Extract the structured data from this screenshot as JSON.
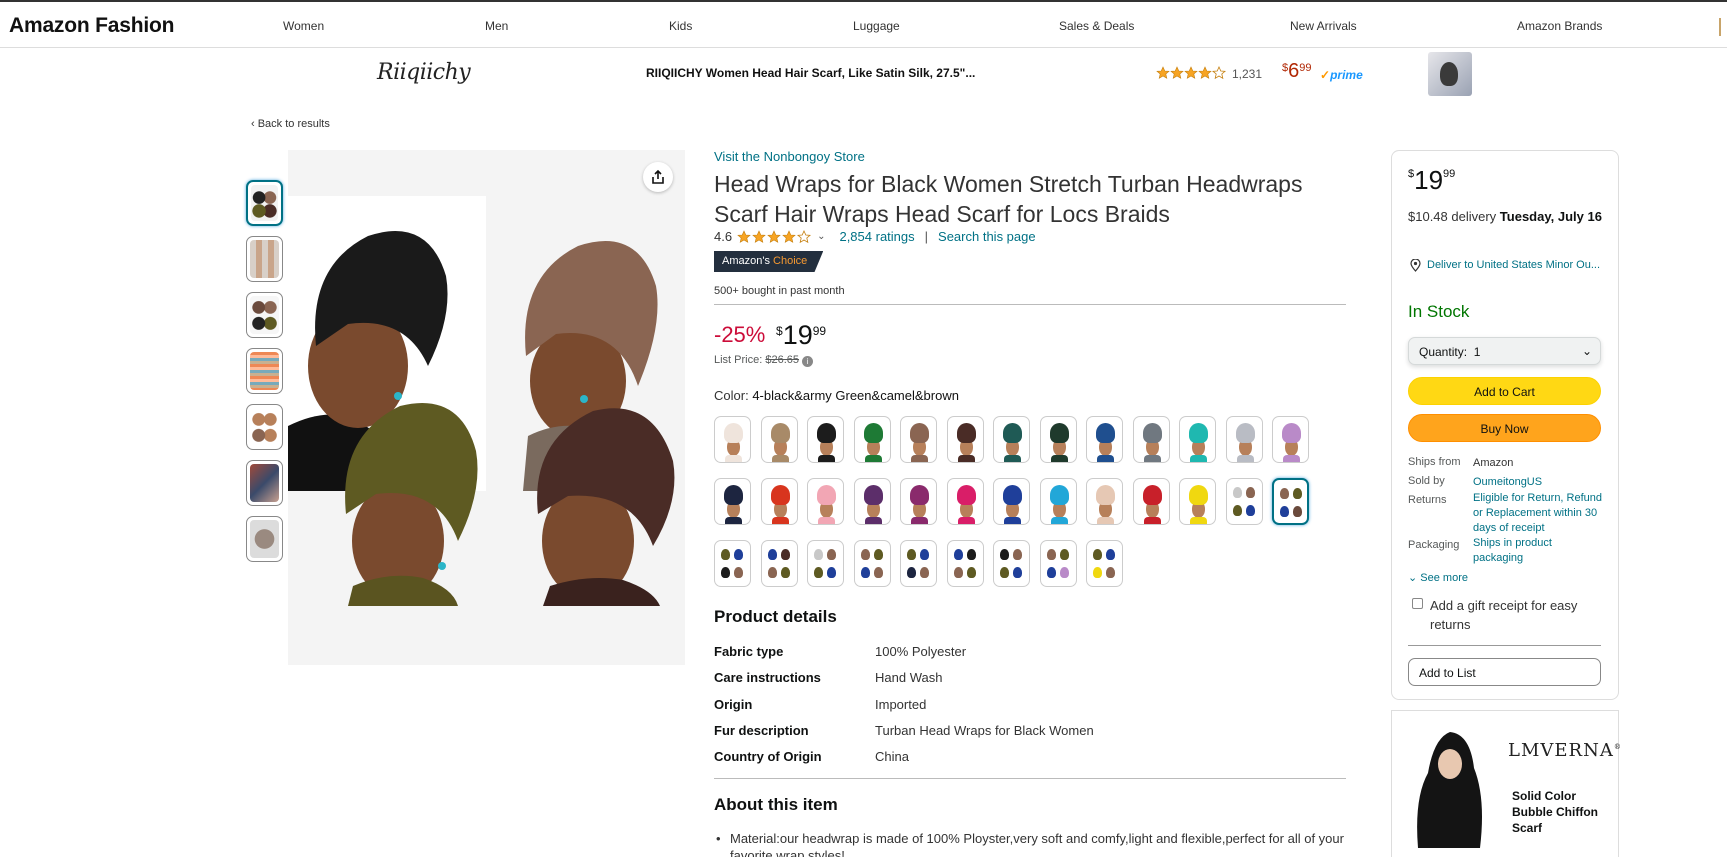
{
  "nav": {
    "brand": "Amazon Fashion",
    "links": [
      "Women",
      "Men",
      "Kids",
      "Luggage",
      "Sales & Deals",
      "New Arrivals",
      "Amazon Brands"
    ]
  },
  "sponsored": {
    "logo": "Riiqiichy",
    "title": "RIIQIICHY Women Head Hair Scarf, Like Satin Silk, 27.5\"...",
    "rating_count": "1,231",
    "price_symbol": "$",
    "price_dollars": "6",
    "price_cents": "99",
    "prime": "prime"
  },
  "back_link": "‹  Back to results",
  "product": {
    "store_link": "Visit the Nonbongoy Store",
    "title": "Head Wraps for Black Women Stretch Turban Headwraps Scarf Hair Wraps Head Scarf for Locs Braids",
    "rating": "4.6",
    "ratings_link": "2,854 ratings",
    "separator": "|",
    "search_link": "Search this page",
    "badge_a": "Amazon's",
    "badge_b": "Choice",
    "bought": "500+ bought in past month",
    "discount": "-25%",
    "price_symbol": "$",
    "price_dollars": "19",
    "price_cents": "99",
    "list_price_label": "List Price:",
    "list_price": "$26.65",
    "color_label": "Color:",
    "color_value": "4-black&army Green&camel&brown"
  },
  "details": {
    "heading": "Product details",
    "rows": [
      {
        "k": "Fabric type",
        "v": "100% Polyester"
      },
      {
        "k": "Care instructions",
        "v": "Hand Wash"
      },
      {
        "k": "Origin",
        "v": "Imported"
      },
      {
        "k": "Fur description",
        "v": "Turban Head Wraps for Black Women"
      },
      {
        "k": "Country of Origin",
        "v": "China"
      }
    ]
  },
  "about": {
    "heading": "About this item",
    "bullet": "Material:our headwrap is made of 100% Ployster,very soft and comfy,light and flexible,perfect for all of your favorite wrap styles!"
  },
  "buybox": {
    "price_symbol": "$",
    "price_dollars": "19",
    "price_cents": "99",
    "delivery": "$10.48 delivery",
    "delivery_date": "Tuesday, July 16",
    "deliver_to": "Deliver to United States Minor Ou...",
    "stock": "In Stock",
    "quantity_label": "Quantity:",
    "quantity_value": "1",
    "add_to_cart": "Add to Cart",
    "buy_now": "Buy Now",
    "ships_from_label": "Ships from",
    "ships_from": "Amazon",
    "sold_by_label": "Sold by",
    "sold_by": "OumeitongUS",
    "returns_label": "Returns",
    "returns": "Eligible for Return, Refund or Replacement within 30 days of receipt",
    "packaging_label": "Packaging",
    "packaging": "Ships in product packaging",
    "see_more": "See more",
    "gift": "Add a gift receipt for easy returns",
    "add_to_list": "Add to List"
  },
  "ad": {
    "logo": "LMVERNA",
    "logo_mark": "®",
    "text": "Solid Color Bubble Chiffon Scarf"
  },
  "swatches": [
    [
      "#efe4dc"
    ],
    [
      "#a88a68"
    ],
    [
      "#1c1c1c"
    ],
    [
      "#1e7a35"
    ],
    [
      "#8a6552"
    ],
    [
      "#4a2c26"
    ],
    [
      "#1f5a55"
    ],
    [
      "#1f3a2c"
    ],
    [
      "#1f4f8f"
    ],
    [
      "#707880"
    ],
    [
      "#1fb8b0"
    ],
    [
      "#b9bcc4"
    ],
    [
      "#b98ac8"
    ],
    [
      "#1d2540"
    ],
    [
      "#d8351e"
    ],
    [
      "#f2a6b4"
    ],
    [
      "#5c2e6a"
    ],
    [
      "#8a2a6c"
    ],
    [
      "#d91e68"
    ],
    [
      "#1f3f9a"
    ],
    [
      "#22a7d8"
    ],
    [
      "#e6c8b4"
    ],
    [
      "#c8202a"
    ],
    [
      "#f0d810"
    ],
    [
      "#c8c8c8"
    ],
    [
      "#6a4a3c"
    ],
    [
      "#1c1c1c"
    ],
    [
      "#4a2c26"
    ],
    [
      "#c8c8c8"
    ],
    [
      "#8a6552"
    ],
    [
      "#1d2540"
    ],
    [
      "#1c1c1c"
    ],
    [
      "#1c1c1c"
    ],
    [
      "#b98ac8"
    ],
    [
      "#f0d810"
    ]
  ]
}
